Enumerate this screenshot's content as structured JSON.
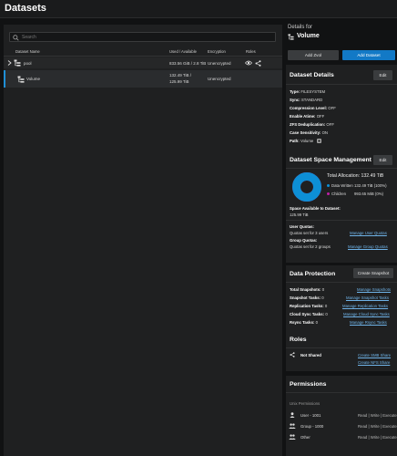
{
  "page": {
    "title": "Datasets"
  },
  "search": {
    "placeholder": "Search"
  },
  "table": {
    "headers": {
      "name": "Dataset Name",
      "used": "Used / Available",
      "encryption": "Encryption",
      "roles": "Roles"
    },
    "rows": [
      {
        "name": "pool",
        "used": "833.56 GiB / 2.8 TiB",
        "encryption": "Unencrypted"
      },
      {
        "name": "Volume",
        "used_line1": "132.49 TiB /",
        "used_line2": "125.99 TiB",
        "encryption": "Unencrypted"
      }
    ]
  },
  "details": {
    "for_label": "Details for",
    "dataset_name": "Volume",
    "add_zvol": "Add Zvol",
    "add_dataset": "Add Dataset"
  },
  "dataset_details": {
    "title": "Dataset Details",
    "edit": "Edit",
    "items": [
      {
        "label": "Type:",
        "value": "FILESYSTEM"
      },
      {
        "label": "Sync:",
        "value": "STANDARD"
      },
      {
        "label": "Compression Level:",
        "value": "OFF"
      },
      {
        "label": "Enable Atime:",
        "value": "OFF"
      },
      {
        "label": "ZFS Deduplication:",
        "value": "OFF"
      },
      {
        "label": "Case Sensitivity:",
        "value": "ON"
      },
      {
        "label": "Path:",
        "value": "Volume"
      }
    ]
  },
  "space": {
    "title": "Dataset Space Management",
    "edit": "Edit",
    "total_label": "Total Allocation:",
    "total_value": "132.49 TiB",
    "data_written_label": "Data Written",
    "data_written_value": "132.49 TiB (100%)",
    "children_label": "Children",
    "children_value": "993.65 MiB (0%)",
    "data_written_fraction": 0.9999,
    "available_label": "Space Available to Dataset:",
    "available_value": "125.99 TiB",
    "user_quotas_label": "User Quotas:",
    "user_quotas_text": "Quotas set for 3 users",
    "user_quotas_link": "Manage User Quotas",
    "group_quotas_label": "Group Quotas:",
    "group_quotas_text": "Quotas set for 2 groups",
    "group_quotas_link": "Manage Group Quotas",
    "colors": {
      "data_written": "#0d8fd6",
      "children": "#c01fa6"
    }
  },
  "protection": {
    "title": "Data Protection",
    "create_snapshot": "Create Snapshot",
    "items": [
      {
        "label": "Total Snapshots:",
        "value": "0",
        "link": "Manage Snapshots"
      },
      {
        "label": "Snapshot Tasks:",
        "value": "0",
        "link": "Manage Snapshot Tasks"
      },
      {
        "label": "Replication Tasks:",
        "value": "0",
        "link": "Manage Replication Tasks"
      },
      {
        "label": "Cloud Sync Tasks:",
        "value": "0",
        "link": "Manage Cloud Sync Tasks"
      },
      {
        "label": "Rsync Tasks:",
        "value": "0",
        "link": "Manage Rsync Tasks"
      }
    ]
  },
  "roles": {
    "title": "Roles",
    "not_shared": "Not Shared",
    "create_smb": "Create SMB Share",
    "create_nfs": "Create NFS Share"
  },
  "permissions": {
    "title": "Permissions",
    "subtitle": "Unix Permissions",
    "items": [
      {
        "label": "User - 1001",
        "value": "Read | Write | Execute"
      },
      {
        "label": "Group - 1000",
        "value": "Read | Write | Execute"
      },
      {
        "label": "Other",
        "value": "Read | Write | Execute"
      }
    ]
  }
}
